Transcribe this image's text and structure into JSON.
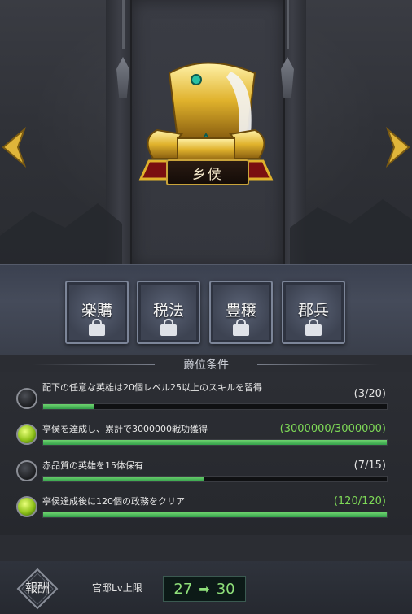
{
  "rank": {
    "title": "乡侯"
  },
  "policies": [
    {
      "label": "楽購",
      "locked": true
    },
    {
      "label": "税法",
      "locked": true
    },
    {
      "label": "豊穣",
      "locked": true
    },
    {
      "label": "郡兵",
      "locked": true
    }
  ],
  "section": {
    "title": "爵位条件"
  },
  "conditions": [
    {
      "text": "配下の任意な英雄は20個レベル25以上のスキルを習得",
      "count": "(3/20)",
      "progress": 0.15,
      "done": false
    },
    {
      "text": "亭侯を達成し、累計で3000000戦功獲得",
      "count": "(3000000/3000000)",
      "progress": 1.0,
      "done": true
    },
    {
      "text": "赤品質の英雄を15体保有",
      "count": "(7/15)",
      "progress": 0.47,
      "done": false
    },
    {
      "text": "亭侯達成後に120個の政務をクリア",
      "count": "(120/120)",
      "progress": 1.0,
      "done": true
    }
  ],
  "bottom": {
    "reward_label": "報酬",
    "level_label": "官邸Lv上限",
    "level_from": "27",
    "level_to": "30",
    "arrow": "➡"
  },
  "colors": {
    "accent_green": "#7ed957",
    "gold": "#c9a33a"
  }
}
